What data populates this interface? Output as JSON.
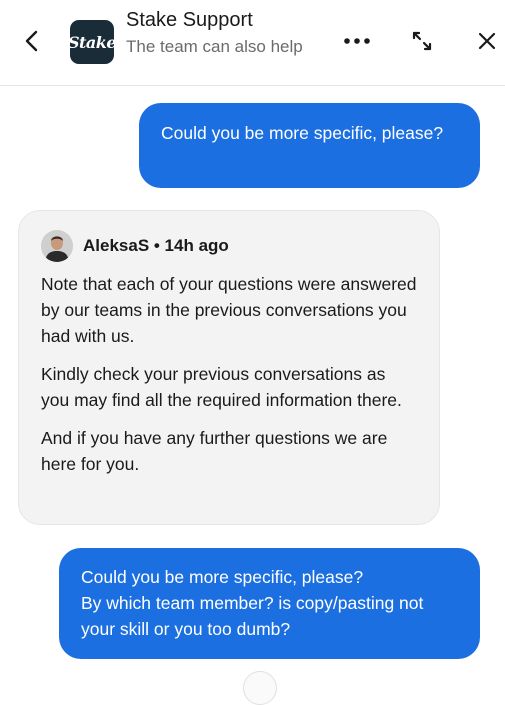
{
  "header": {
    "back_icon": "chevron-left-icon",
    "logo_text": "Stake",
    "logo_color": "#1a2c38",
    "title": "Stake Support",
    "subtitle": "The team can also help",
    "more_icon": "more-horizontal-icon",
    "expand_icon": "expand-icon",
    "close_icon": "close-icon"
  },
  "messages": [
    {
      "direction": "outgoing",
      "lines": [
        "Could you be more specific, please?"
      ]
    },
    {
      "direction": "incoming",
      "author": "AleksaS • 14h ago",
      "paragraphs": [
        "Note that each of your questions were answered by our teams in the previous conversations you had with us.",
        "Kindly check your previous conversations as you may find all the required information there.",
        "And if you have any further questions we are here for you."
      ]
    },
    {
      "direction": "outgoing",
      "lines": [
        "Could you be more specific, please?",
        "By which team member? is copy/pasting not your skill or you too dumb?"
      ]
    }
  ],
  "colors": {
    "outgoing_bubble": "#1b6fe0",
    "incoming_bubble": "#f3f3f3"
  }
}
